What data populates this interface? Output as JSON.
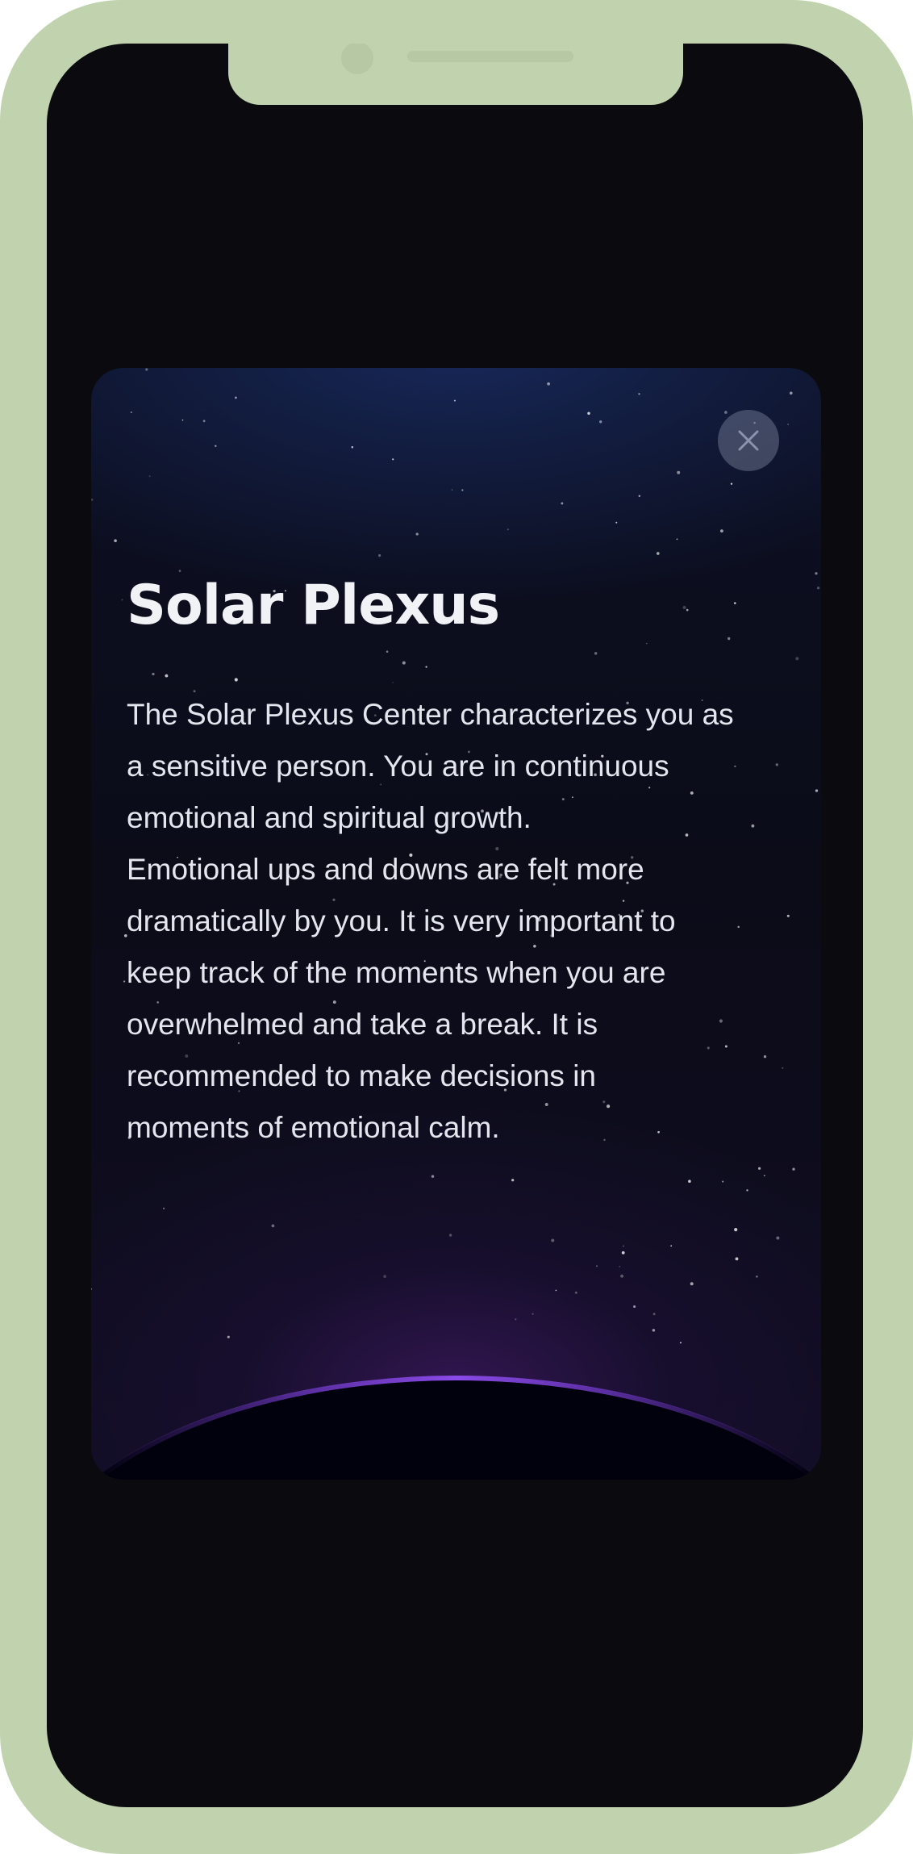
{
  "device": {
    "frame_color": "#c0d3ae",
    "screen_background": "#0b0b0f"
  },
  "modal": {
    "title": "Solar Plexus",
    "body_lines": [
      "The Solar Plexus Center characterizes you as",
      "a sensitive person. You are in continuous",
      "emotional and spiritual growth.",
      "Emotional ups and downs are felt more",
      "dramatically by you. It is very important to",
      "keep track of the moments when you are",
      "overwhelmed and take a break. It is",
      "recommended to make decisions in",
      "moments of emotional calm."
    ],
    "close_icon": "close-icon",
    "colors": {
      "sky_top": "#17295b",
      "glow_bottom": "#3e1962",
      "horizon_rim": "#7b3fd6",
      "planet": "#01010d"
    }
  }
}
